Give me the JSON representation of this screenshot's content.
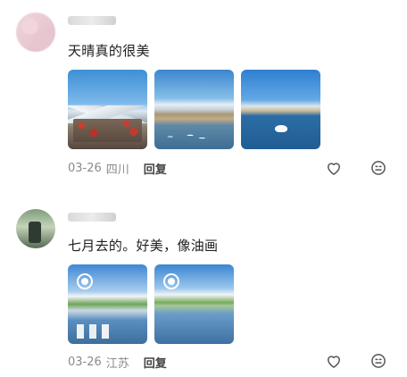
{
  "comments": [
    {
      "text": "天晴真的很美",
      "date": "03-26",
      "location": "四川",
      "reply_label": "回复",
      "photos": [
        {
          "icon": "photo-mountains-lanterns"
        },
        {
          "icon": "photo-lake-swans"
        },
        {
          "icon": "photo-blue-lake-swan"
        }
      ]
    },
    {
      "text": "七月去的。好美，像油画",
      "date": "03-26",
      "location": "江苏",
      "reply_label": "回复",
      "photos": [
        {
          "icon": "photo-grassland-lake",
          "badge": "live-photo-icon"
        },
        {
          "icon": "photo-lake-grassland",
          "badge": "live-photo-icon"
        }
      ]
    }
  ],
  "icons": {
    "like": "heart-outline-icon",
    "more": "emoji-face-icon"
  },
  "colors": {
    "text_primary": "#1e1e1e",
    "text_meta": "#8a8a8a",
    "reply": "#444444",
    "icon": "#555555"
  }
}
